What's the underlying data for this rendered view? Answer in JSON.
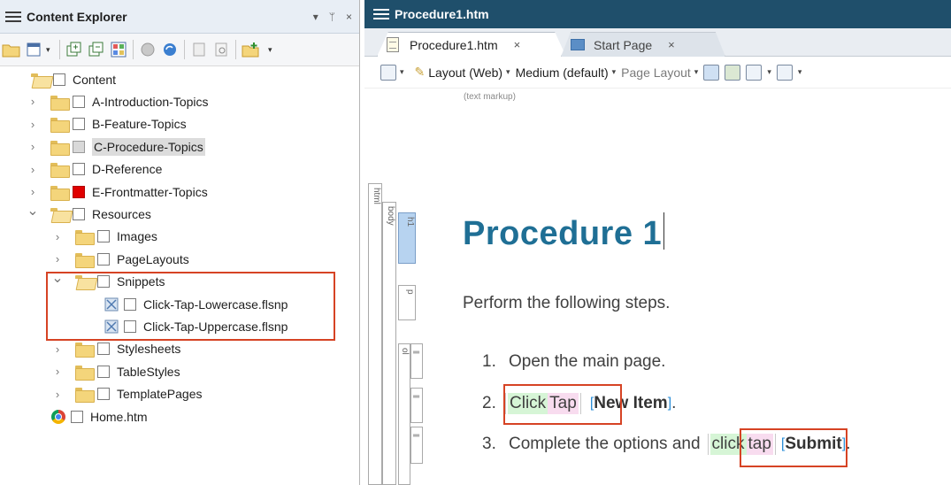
{
  "left_panel": {
    "title": "Content Explorer",
    "controls": [
      "▾",
      "ᛘ",
      "×"
    ]
  },
  "tree": {
    "items": [
      {
        "label": "Content",
        "level": 0,
        "expanded": true,
        "checkbox": "empty"
      },
      {
        "label": "A-Introduction-Topics",
        "level": 1,
        "expanded": false,
        "checkbox": "empty"
      },
      {
        "label": "B-Feature-Topics",
        "level": 1,
        "expanded": false,
        "checkbox": "empty"
      },
      {
        "label": "C-Procedure-Topics",
        "level": 1,
        "expanded": false,
        "checkbox": "grey",
        "selected": true
      },
      {
        "label": "D-Reference",
        "level": 1,
        "expanded": false,
        "checkbox": "empty"
      },
      {
        "label": "E-Frontmatter-Topics",
        "level": 1,
        "expanded": false,
        "checkbox": "red"
      },
      {
        "label": "Resources",
        "level": 1,
        "expanded": true,
        "checkbox": "empty"
      },
      {
        "label": "Images",
        "level": 2,
        "expanded": false,
        "checkbox": "empty"
      },
      {
        "label": "PageLayouts",
        "level": 2,
        "expanded": false,
        "checkbox": "empty"
      },
      {
        "label": "Snippets",
        "level": 2,
        "expanded": true,
        "checkbox": "empty"
      },
      {
        "label": "Click-Tap-Lowercase.flsnp",
        "level": 3,
        "file": true,
        "checkbox": "empty"
      },
      {
        "label": "Click-Tap-Uppercase.flsnp",
        "level": 3,
        "file": true,
        "checkbox": "empty"
      },
      {
        "label": "Stylesheets",
        "level": 2,
        "expanded": false,
        "checkbox": "empty"
      },
      {
        "label": "TableStyles",
        "level": 2,
        "expanded": false,
        "checkbox": "empty"
      },
      {
        "label": "TemplatePages",
        "level": 2,
        "expanded": false,
        "checkbox": "empty"
      },
      {
        "label": "Home.htm",
        "level": 1,
        "chrome": true,
        "checkbox": "empty"
      }
    ]
  },
  "right_panel": {
    "title": "Procedure1.htm",
    "tabs": [
      {
        "label": "Procedure1.htm",
        "close": "×"
      },
      {
        "label": "Start Page",
        "close": "×"
      }
    ],
    "toolbar": {
      "layout": "Layout (Web)",
      "medium": "Medium (default)",
      "page_layout": "Page Layout"
    },
    "markup_label": "(text markup)",
    "structure_labels": {
      "html": "html",
      "body": "body",
      "h1": "h1",
      "p": "p",
      "ol": "ol"
    }
  },
  "document": {
    "title": "Procedure 1",
    "intro": "Perform the following steps.",
    "steps": [
      {
        "num": "1.",
        "text": "Open the main page."
      },
      {
        "num": "2.",
        "snippet_a": "Click",
        "snippet_b": "Tap",
        "ui_text": "New Item",
        "after": "."
      },
      {
        "num": "3.",
        "before": "Complete the options and",
        "snippet_a": "click",
        "snippet_b": "tap",
        "ui_text": "Submit",
        "after": "."
      }
    ]
  },
  "colors": {
    "highlight_border": "#d64324",
    "right_title_bg": "#1f4f6b",
    "heading": "#1f6f95"
  }
}
